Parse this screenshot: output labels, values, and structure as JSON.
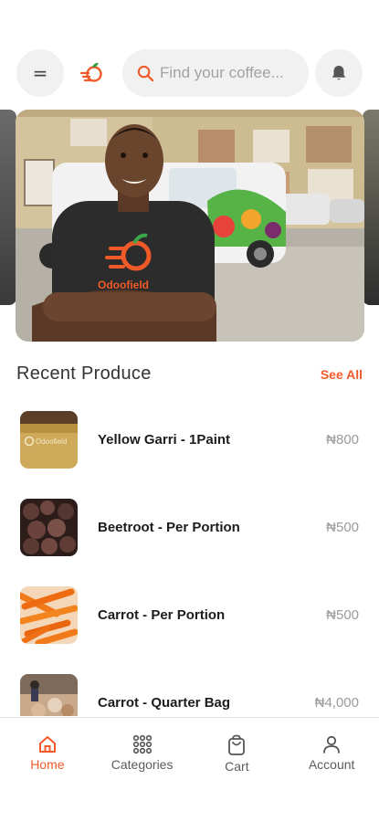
{
  "header": {
    "search_placeholder": "Find your coffee...",
    "accent": "#f05a28"
  },
  "banner": {
    "shirt_text": "Odoofield"
  },
  "section": {
    "title": "Recent Produce",
    "see_all": "See All"
  },
  "products": [
    {
      "name": "Yellow Garri - 1Paint",
      "price": "₦800",
      "thumb_text": "Odoofield"
    },
    {
      "name": "Beetroot - Per Portion",
      "price": "₦500"
    },
    {
      "name": "Carrot - Per Portion",
      "price": "₦500"
    },
    {
      "name": "Carrot - Quarter Bag",
      "price": "₦4,000"
    }
  ],
  "nav": {
    "items": [
      {
        "label": "Home",
        "icon": "home-icon",
        "active": true
      },
      {
        "label": "Categories",
        "icon": "grid-icon",
        "active": false
      },
      {
        "label": "Cart",
        "icon": "cart-icon",
        "active": false
      },
      {
        "label": "Account",
        "icon": "user-icon",
        "active": false
      }
    ]
  }
}
